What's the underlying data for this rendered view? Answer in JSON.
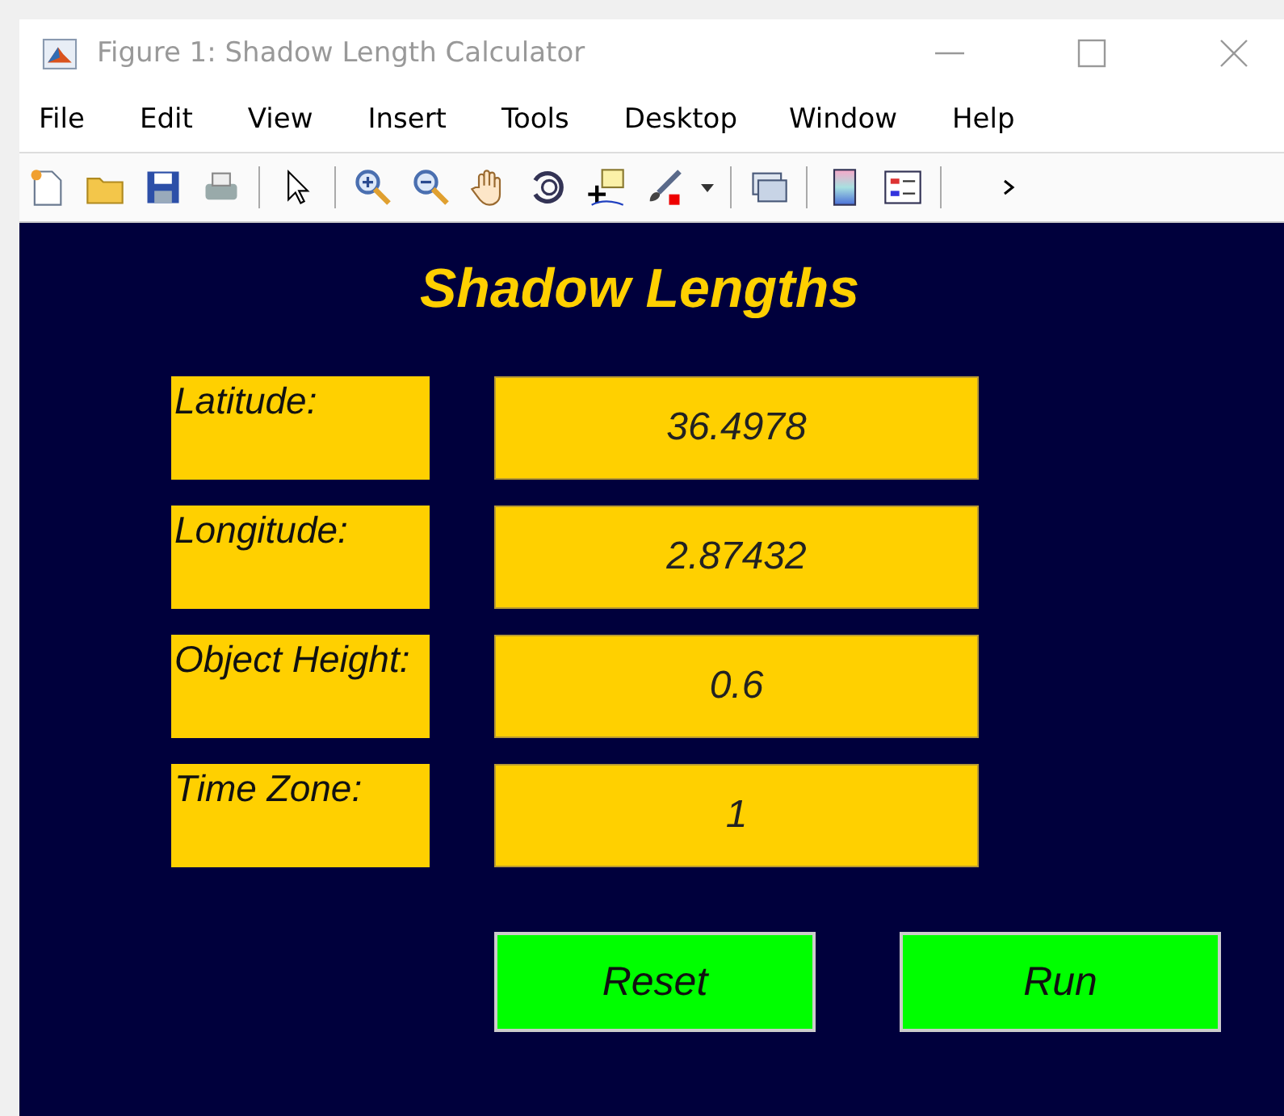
{
  "window": {
    "title": "Figure 1: Shadow Length Calculator"
  },
  "menu": [
    "File",
    "Edit",
    "View",
    "Insert",
    "Tools",
    "Desktop",
    "Window",
    "Help"
  ],
  "heading": "Shadow Lengths",
  "fields": [
    {
      "label": "Latitude:",
      "value": "36.4978"
    },
    {
      "label": "Longitude:",
      "value": "2.87432"
    },
    {
      "label": "Object Height:",
      "value": "0.6"
    },
    {
      "label": "Time Zone:",
      "value": "1"
    }
  ],
  "buttons": [
    "Reset",
    "Run"
  ]
}
